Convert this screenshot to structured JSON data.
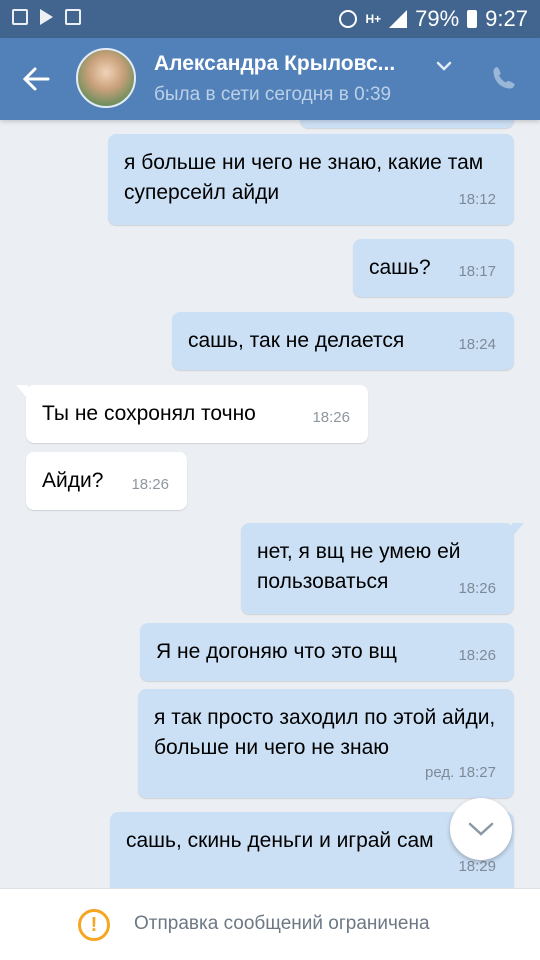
{
  "status_bar": {
    "battery": "79%",
    "time": "9:27"
  },
  "header": {
    "name": "Александра Крыловс...",
    "status": "была в сети сегодня в 0:39"
  },
  "messages": [
    {
      "dir": "out",
      "text": "я больше ни чего не знаю, какие там суперсейл айди",
      "time": "18:12"
    },
    {
      "dir": "out",
      "text": "сашь?",
      "time": "18:17"
    },
    {
      "dir": "out",
      "text": "сашь, так не делается",
      "time": "18:24"
    },
    {
      "dir": "in",
      "text": "Ты не сохронял точно",
      "time": "18:26"
    },
    {
      "dir": "in",
      "text": "Айди?",
      "time": "18:26"
    },
    {
      "dir": "out",
      "text": "нет, я вщ не умею ей пользоваться",
      "time": "18:26"
    },
    {
      "dir": "out",
      "text": "Я не догоняю что это вщ",
      "time": "18:26"
    },
    {
      "dir": "out",
      "text": "я так просто заходил по этой айди, больше ни чего не знаю",
      "time": "ред. 18:27"
    },
    {
      "dir": "out",
      "text": "сашь, скинь деньги и играй сам",
      "time": "18:29"
    }
  ],
  "bottom": {
    "notice": "Отправка сообщений ограничена"
  },
  "colors": {
    "header": "#5181b8",
    "statusbar": "#42658f",
    "outgoing": "#cce0f5",
    "incoming": "#ffffff",
    "warning": "#f5a623"
  }
}
